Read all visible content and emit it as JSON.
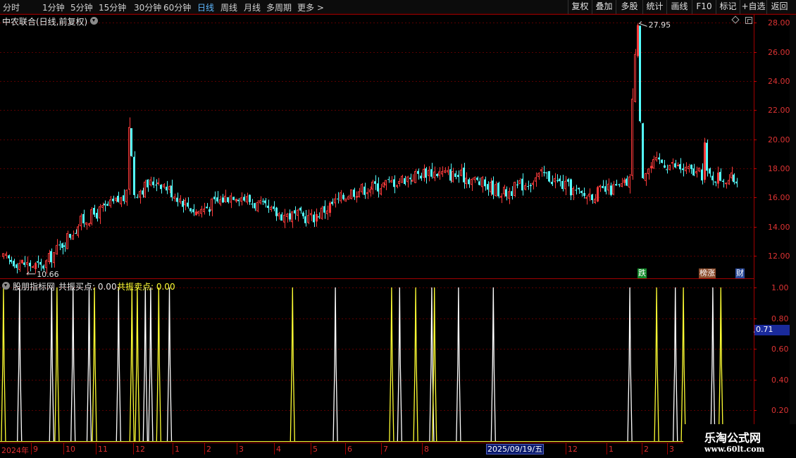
{
  "toolbar": {
    "periods": [
      "分时",
      "1分钟",
      "5分钟",
      "15分钟",
      "30分钟",
      "60分钟",
      "日线",
      "周线",
      "月线",
      "多周期",
      "更多 >"
    ],
    "active_period": "日线",
    "buttons": [
      "复权",
      "叠加",
      "多股",
      "统计",
      "画线",
      "F10",
      "标记",
      "+自选",
      "返回"
    ]
  },
  "main": {
    "stock_title": "中农联合(日线,前复权)",
    "max_label": "27.95",
    "min_label": "10.66",
    "badges": {
      "die": "跌",
      "bang": "榜涨",
      "cai": "财"
    }
  },
  "indicator": {
    "name": "股朋指标网",
    "buy_label": "共振买点: 0.00",
    "sell_label": "共振卖点: 0.00",
    "cursor_value": "0.71"
  },
  "time_axis": {
    "year_label": "2024年",
    "labels": [
      "9",
      "10",
      "11",
      "12",
      "1",
      "2",
      "3",
      "4",
      "5",
      "6",
      "7",
      "8",
      "9",
      "12",
      "1",
      "2",
      "3"
    ],
    "selected_date": "2025/09/19/五"
  },
  "watermark": {
    "title": "乐淘公式网",
    "url": "www.60lt.com"
  },
  "colors": {
    "up": "#ff3b3b",
    "down": "#54ffff",
    "buy_signal": "#ffffff",
    "sell_signal": "#ffff33",
    "grid": "#5a0000"
  },
  "chart_data": [
    {
      "type": "candlestick",
      "title": "中农联合(日线,前复权)",
      "y_ticks": [
        "28.00",
        "26.00",
        "24.00",
        "22.00",
        "20.00",
        "18.00",
        "16.00",
        "14.00",
        "12.00"
      ],
      "ylim": [
        10.5,
        28.5
      ],
      "x_tick_labels": [
        "2024年",
        "9",
        "10",
        "11",
        "12",
        "1",
        "2",
        "3",
        "4",
        "5",
        "6",
        "7",
        "8",
        "9",
        "12",
        "1",
        "2",
        "3"
      ],
      "max": 27.95,
      "min": 10.66,
      "approx_close_path": [
        {
          "month": "2024-08",
          "value": 11.8
        },
        {
          "month": "2024-09",
          "value": 11.2
        },
        {
          "month": "2024-10",
          "value": 14.3
        },
        {
          "month": "2024-11",
          "value": 15.8
        },
        {
          "month": "2024-12",
          "value": 17.2
        },
        {
          "month": "2025-01",
          "value": 15.0
        },
        {
          "month": "2025-02",
          "value": 16.3
        },
        {
          "month": "2025-03",
          "value": 14.9
        },
        {
          "month": "2025-04",
          "value": 14.6
        },
        {
          "month": "2025-05",
          "value": 16.4
        },
        {
          "month": "2025-06",
          "value": 17.0
        },
        {
          "month": "2025-07",
          "value": 17.8
        },
        {
          "month": "2025-08",
          "value": 17.4
        },
        {
          "month": "2025-09",
          "value": 16.3
        },
        {
          "month": "2025-10",
          "value": 17.6
        },
        {
          "month": "2025-11",
          "value": 16.1
        },
        {
          "month": "2025-12",
          "value": 16.7
        },
        {
          "month": "2026-01",
          "value": 18.5
        },
        {
          "month": "2026-02",
          "value": 17.6
        },
        {
          "month": "2026-03",
          "value": 17.2
        }
      ]
    },
    {
      "type": "line",
      "title": "股朋指标网",
      "y_ticks": [
        "1.00",
        "0.80",
        "0.60",
        "0.40",
        "0.20"
      ],
      "ylim": [
        0,
        1.05
      ],
      "series": [
        {
          "name": "共振买点",
          "color": "#ffffff",
          "spike_height": 1.0,
          "spike_bar_index": [
            6,
            18,
            26,
            32,
            43,
            53,
            55,
            62,
            124,
            148,
            160,
            170,
            183,
            234,
            251,
            265
          ]
        },
        {
          "name": "共振卖点",
          "color": "#ffff33",
          "spike_height": 1.0,
          "spike_bar_index": [
            0,
            20,
            34,
            48,
            50,
            58,
            108,
            145,
            154,
            161,
            244,
            254,
            268
          ]
        }
      ]
    }
  ]
}
